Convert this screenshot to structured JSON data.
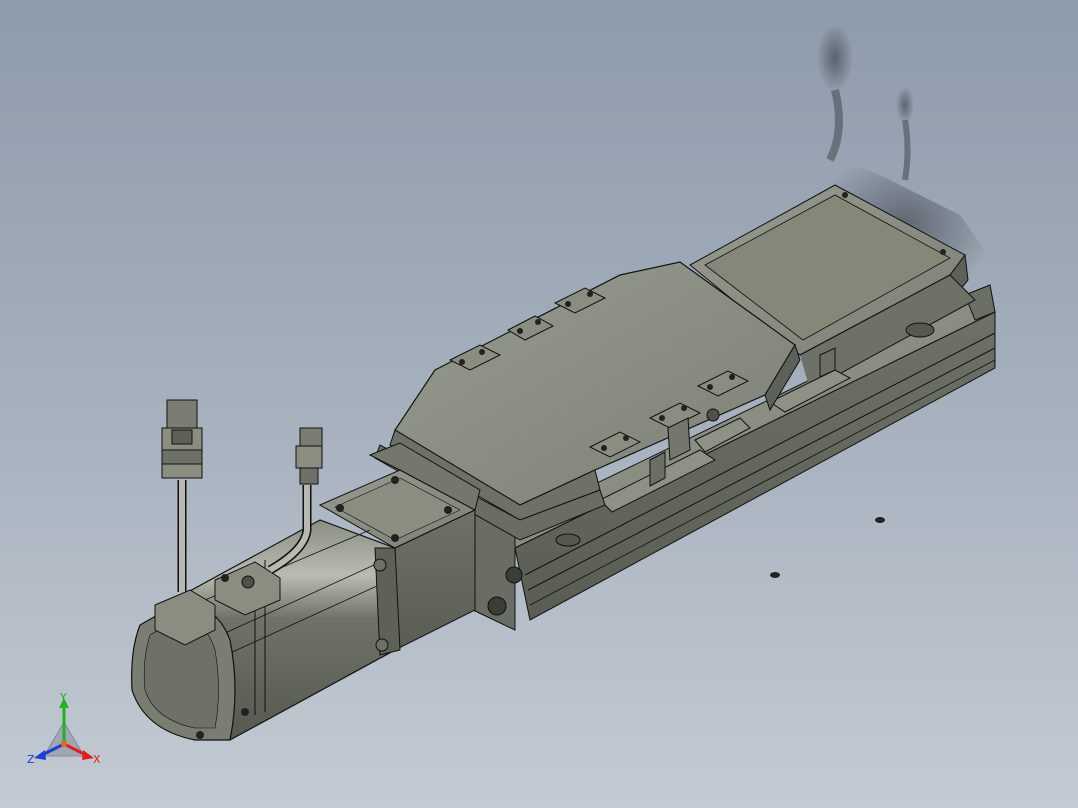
{
  "viewport": {
    "background_top": "#8e9bab",
    "background_bottom": "#c3cad3",
    "model_fill": "#7a7d72",
    "model_fill_light": "#8e9186",
    "model_fill_dark": "#5e6158",
    "edge_color": "#111111"
  },
  "triad": {
    "x_label": "X",
    "y_label": "Y",
    "z_label": "Z",
    "x_color": "#e0201b",
    "y_color": "#21b321",
    "z_color": "#1c3fd6"
  }
}
